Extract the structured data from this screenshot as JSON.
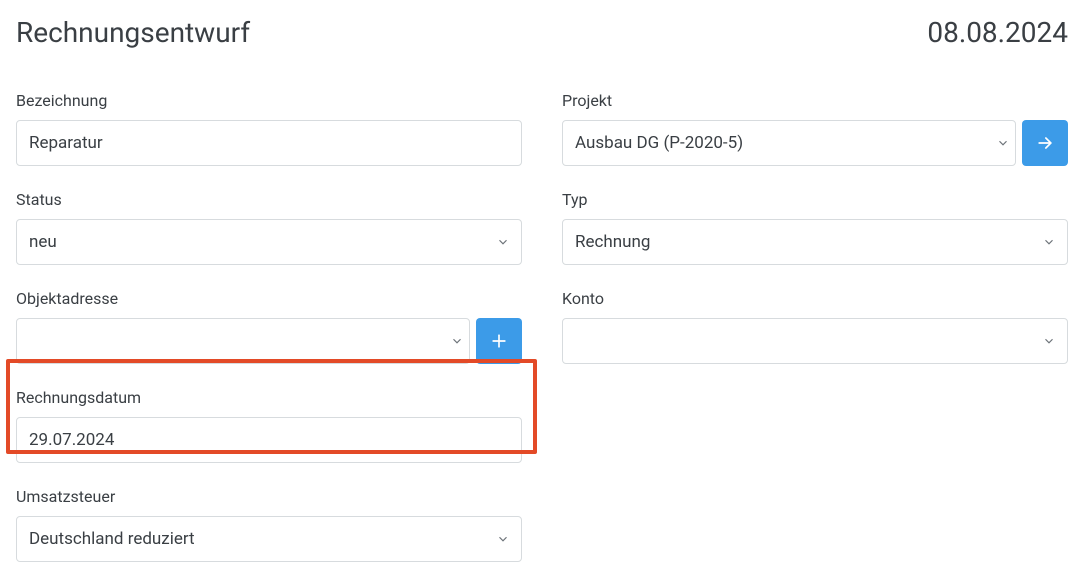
{
  "header": {
    "title": "Rechnungsentwurf",
    "date": "08.08.2024"
  },
  "fields": {
    "bezeichnung": {
      "label": "Bezeichnung",
      "value": "Reparatur"
    },
    "projekt": {
      "label": "Projekt",
      "value": "Ausbau DG (P-2020-5)"
    },
    "status": {
      "label": "Status",
      "value": "neu"
    },
    "typ": {
      "label": "Typ",
      "value": "Rechnung"
    },
    "objektadresse": {
      "label": "Objektadresse",
      "value": ""
    },
    "konto": {
      "label": "Konto",
      "value": ""
    },
    "rechnungsdatum": {
      "label": "Rechnungsdatum",
      "value": "29.07.2024"
    },
    "umsatzsteuer": {
      "label": "Umsatzsteuer",
      "value": "Deutschland reduziert"
    }
  },
  "icons": {
    "chevron": "chevron-down-icon",
    "plus": "plus-icon",
    "arrow": "arrow-right-icon"
  }
}
